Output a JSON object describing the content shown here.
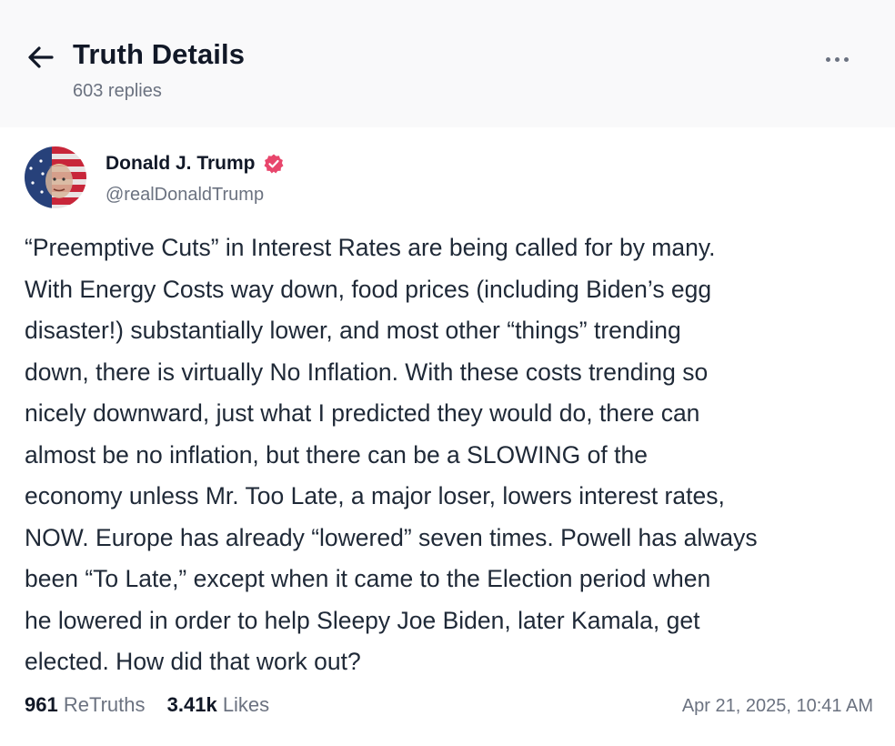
{
  "header": {
    "title": "Truth Details",
    "subtitle": "603 replies",
    "back_icon": "arrow-left-icon",
    "more_icon": "more-horizontal-icon"
  },
  "post": {
    "author": {
      "name": "Donald J. Trump",
      "handle": "@realDonaldTrump",
      "verified": true,
      "verified_color": "#e8466c"
    },
    "text": "“Preemptive Cuts” in Interest Rates are being called for by many.\nWith Energy Costs way down, food prices (including Biden’s egg\ndisaster!) substantially lower, and most other “things” trending\ndown, there is virtually No Inflation. With these costs trending so\nnicely downward, just what I predicted they would do, there can\nalmost be no inflation, but there can be a SLOWING of the\neconomy unless Mr. Too Late, a major loser, lowers interest rates,\nNOW. Europe has already “lowered” seven times. Powell has always\nbeen “To Late,” except when it came to the Election period when\nhe lowered in order to help Sleepy Joe Biden, later Kamala, get\nelected. How did that work out?",
    "stats": {
      "retruths_count": "961",
      "retruths_label": "ReTruths",
      "likes_count": "3.41k",
      "likes_label": "Likes"
    },
    "timestamp": "Apr 21, 2025, 10:41 AM"
  }
}
